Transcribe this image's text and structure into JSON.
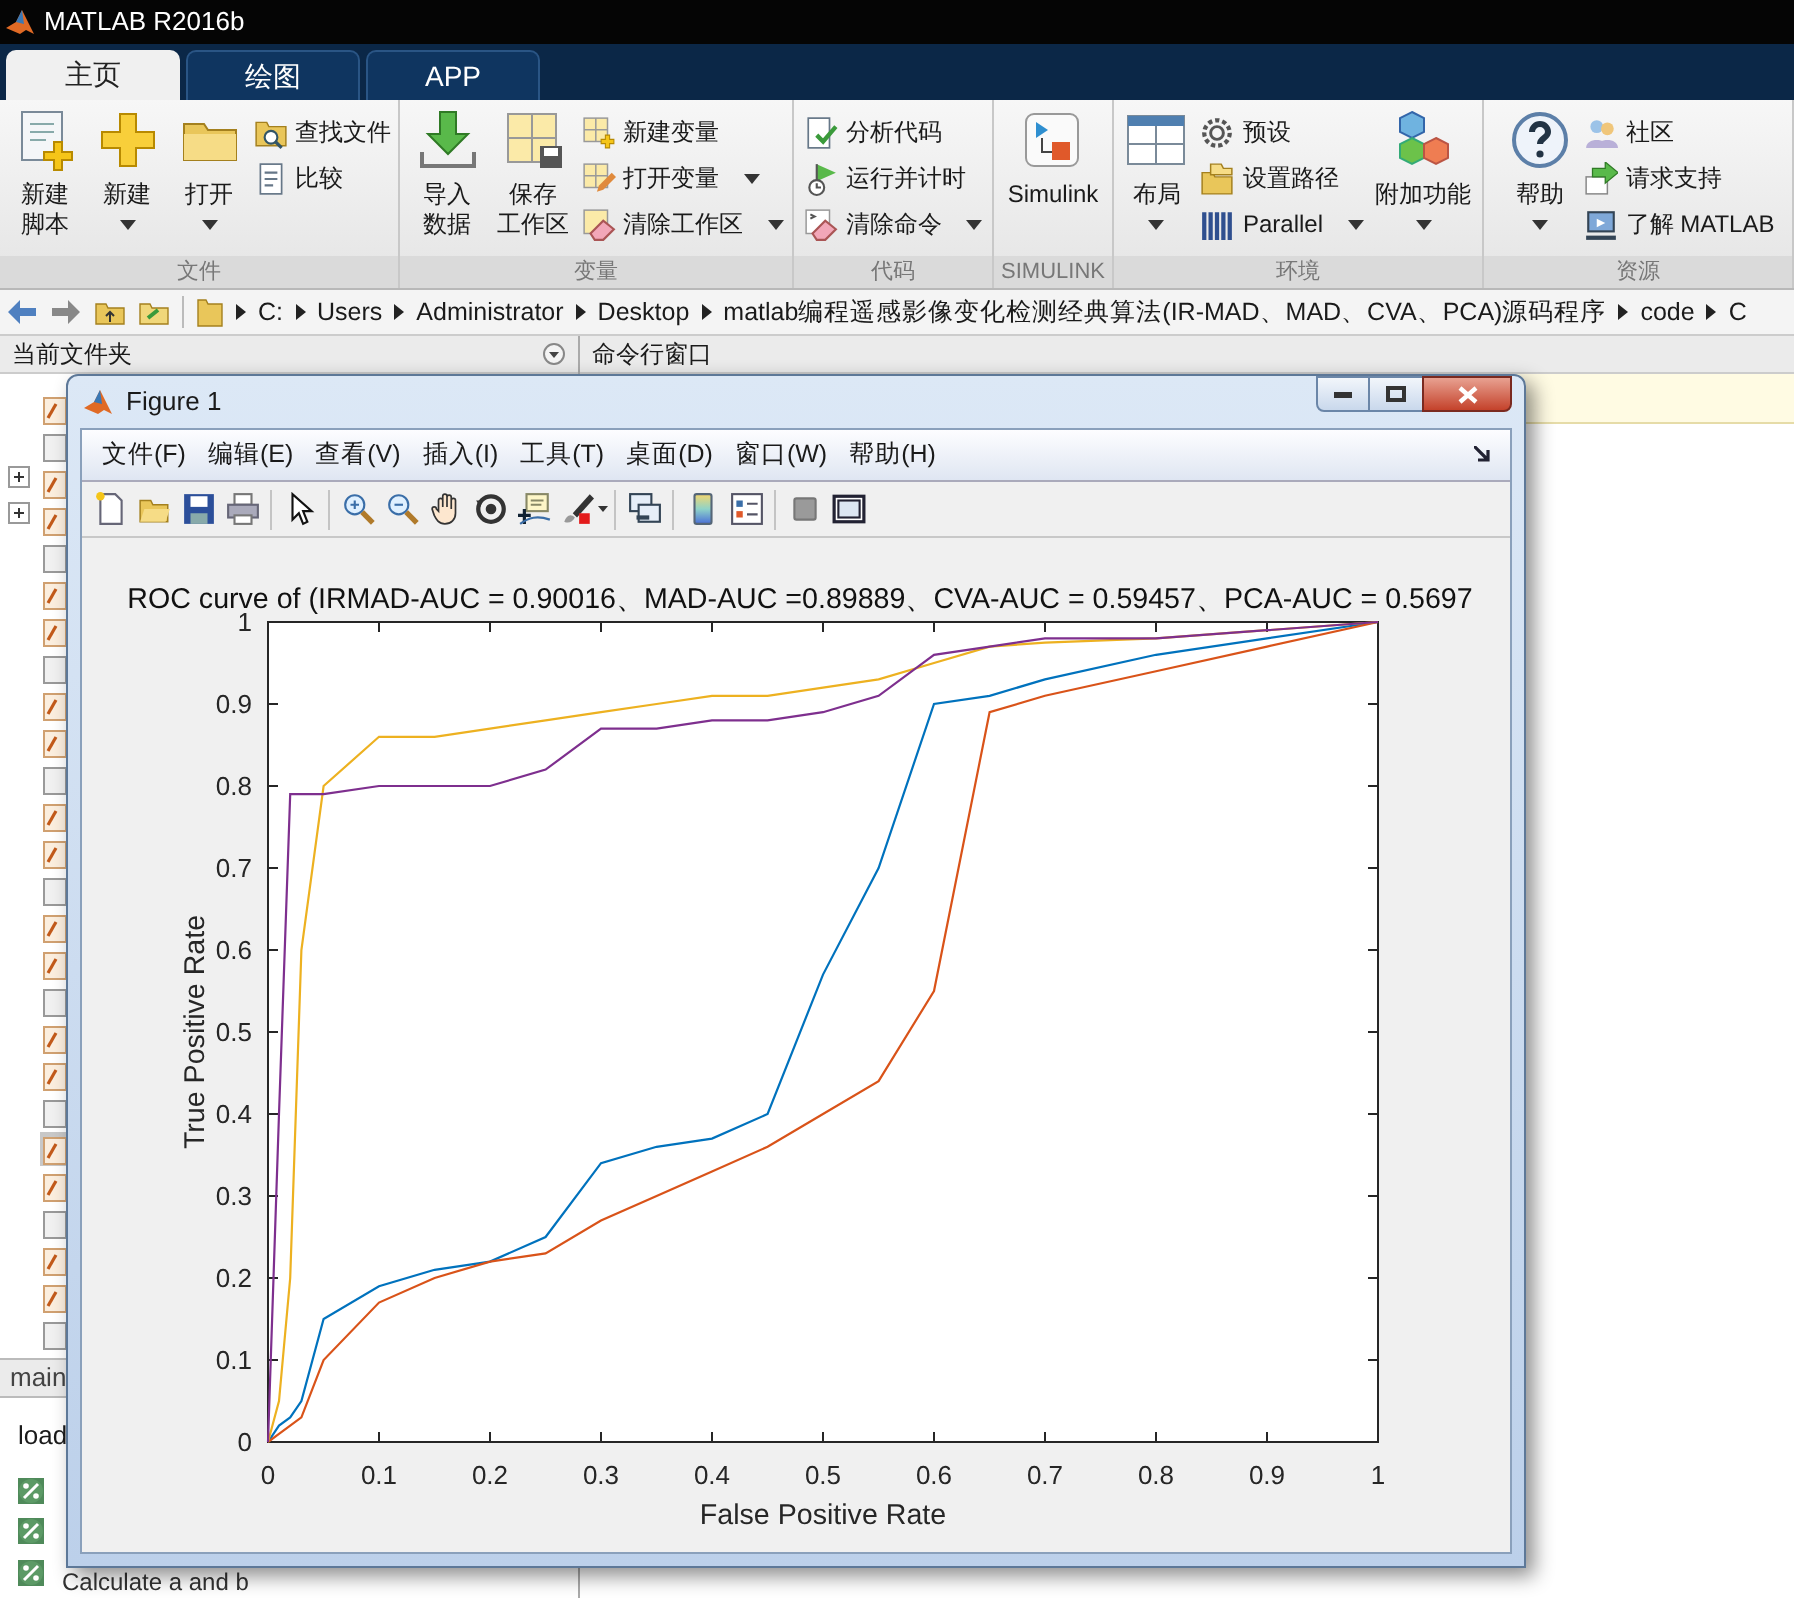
{
  "app_title": "MATLAB R2016b",
  "ribbon_tabs": [
    {
      "label": "主页",
      "selected": true
    },
    {
      "label": "绘图",
      "selected": false
    },
    {
      "label": "APP",
      "selected": false
    }
  ],
  "ribbon_groups": [
    {
      "label": "文件",
      "items": [
        {
          "kind": "large",
          "label": "新建脚本",
          "dropdown": false
        },
        {
          "kind": "large",
          "label": "新建",
          "dropdown": true
        },
        {
          "kind": "large",
          "label": "打开",
          "dropdown": true
        },
        {
          "kind": "small",
          "label": "查找文件",
          "dropdown": false
        },
        {
          "kind": "small",
          "label": "比较",
          "dropdown": false
        }
      ]
    },
    {
      "label": "变量",
      "items": [
        {
          "kind": "large",
          "label": "导入数据",
          "dropdown": false
        },
        {
          "kind": "large",
          "label": "保存工作区",
          "dropdown": false
        },
        {
          "kind": "small",
          "label": "新建变量",
          "dropdown": false
        },
        {
          "kind": "small",
          "label": "打开变量",
          "dropdown": true
        },
        {
          "kind": "small",
          "label": "清除工作区",
          "dropdown": true
        }
      ]
    },
    {
      "label": "代码",
      "items": [
        {
          "kind": "small",
          "label": "分析代码",
          "dropdown": false
        },
        {
          "kind": "small",
          "label": "运行并计时",
          "dropdown": false
        },
        {
          "kind": "small",
          "label": "清除命令",
          "dropdown": true
        }
      ]
    },
    {
      "label": "SIMULINK",
      "items": [
        {
          "kind": "large",
          "label": "Simulink",
          "dropdown": false
        }
      ]
    },
    {
      "label": "环境",
      "items": [
        {
          "kind": "large",
          "label": "布局",
          "dropdown": true
        },
        {
          "kind": "small",
          "label": "预设",
          "dropdown": false
        },
        {
          "kind": "small",
          "label": "设置路径",
          "dropdown": false
        },
        {
          "kind": "small",
          "label": "Parallel",
          "dropdown": true
        },
        {
          "kind": "large",
          "label": "附加功能",
          "dropdown": true
        }
      ]
    },
    {
      "label": "资源",
      "items": [
        {
          "kind": "large",
          "label": "帮助",
          "dropdown": true
        },
        {
          "kind": "small",
          "label": "社区",
          "dropdown": false
        },
        {
          "kind": "small",
          "label": "请求支持",
          "dropdown": false
        },
        {
          "kind": "small",
          "label": "了解 MATLAB",
          "dropdown": false
        }
      ]
    }
  ],
  "address_path": [
    "C:",
    "Users",
    "Administrator",
    "Desktop",
    "matlab编程遥感影像变化检测经典算法(IR-MAD、MAD、CVA、PCA)源码程序",
    "code",
    "C"
  ],
  "current_folder": {
    "title": "当前文件夹"
  },
  "details": {
    "tab": "main",
    "lines": [
      "load",
      "Calculate a and b"
    ]
  },
  "command_window": {
    "title": "命令行窗口"
  },
  "figure": {
    "title": "Figure 1",
    "menus": [
      "文件(F)",
      "编辑(E)",
      "查看(V)",
      "插入(I)",
      "工具(T)",
      "桌面(D)",
      "窗口(W)",
      "帮助(H)"
    ],
    "chart_data": {
      "type": "line",
      "title": "ROC curve of (IRMAD-AUC = 0.90016、MAD-AUC =0.89889、CVA-AUC = 0.59457、PCA-AUC = 0.5697",
      "xlabel": "False Positive Rate",
      "ylabel": "True Positive Rate",
      "x": [
        0,
        0.01,
        0.02,
        0.03,
        0.05,
        0.1,
        0.15,
        0.2,
        0.25,
        0.3,
        0.35,
        0.4,
        0.45,
        0.5,
        0.55,
        0.6,
        0.65,
        0.7,
        0.8,
        0.9,
        1
      ],
      "series": [
        {
          "color": "#0072bd",
          "values": [
            0,
            0.02,
            0.03,
            0.05,
            0.15,
            0.19,
            0.21,
            0.22,
            0.25,
            0.34,
            0.36,
            0.37,
            0.4,
            0.57,
            0.7,
            0.9,
            0.91,
            0.93,
            0.96,
            0.98,
            1
          ]
        },
        {
          "color": "#d95319",
          "values": [
            0,
            0.01,
            0.02,
            0.03,
            0.1,
            0.17,
            0.2,
            0.22,
            0.23,
            0.27,
            0.3,
            0.33,
            0.36,
            0.4,
            0.44,
            0.55,
            0.89,
            0.91,
            0.94,
            0.97,
            1
          ]
        },
        {
          "color": "#edb120",
          "values": [
            0,
            0.05,
            0.2,
            0.6,
            0.8,
            0.86,
            0.86,
            0.87,
            0.88,
            0.89,
            0.9,
            0.91,
            0.91,
            0.92,
            0.93,
            0.95,
            0.97,
            0.975,
            0.98,
            0.99,
            1
          ]
        },
        {
          "color": "#7e2f8e",
          "values": [
            0,
            0.4,
            0.79,
            0.79,
            0.79,
            0.8,
            0.8,
            0.8,
            0.82,
            0.87,
            0.87,
            0.88,
            0.88,
            0.89,
            0.91,
            0.96,
            0.97,
            0.98,
            0.98,
            0.99,
            1
          ]
        }
      ],
      "xlim": [
        0,
        1
      ],
      "ylim": [
        0,
        1
      ],
      "xticks": [
        0,
        0.1,
        0.2,
        0.3,
        0.4,
        0.5,
        0.6,
        0.7,
        0.8,
        0.9,
        1
      ],
      "yticks": [
        0,
        0.1,
        0.2,
        0.3,
        0.4,
        0.5,
        0.6,
        0.7,
        0.8,
        0.9,
        1
      ]
    }
  }
}
